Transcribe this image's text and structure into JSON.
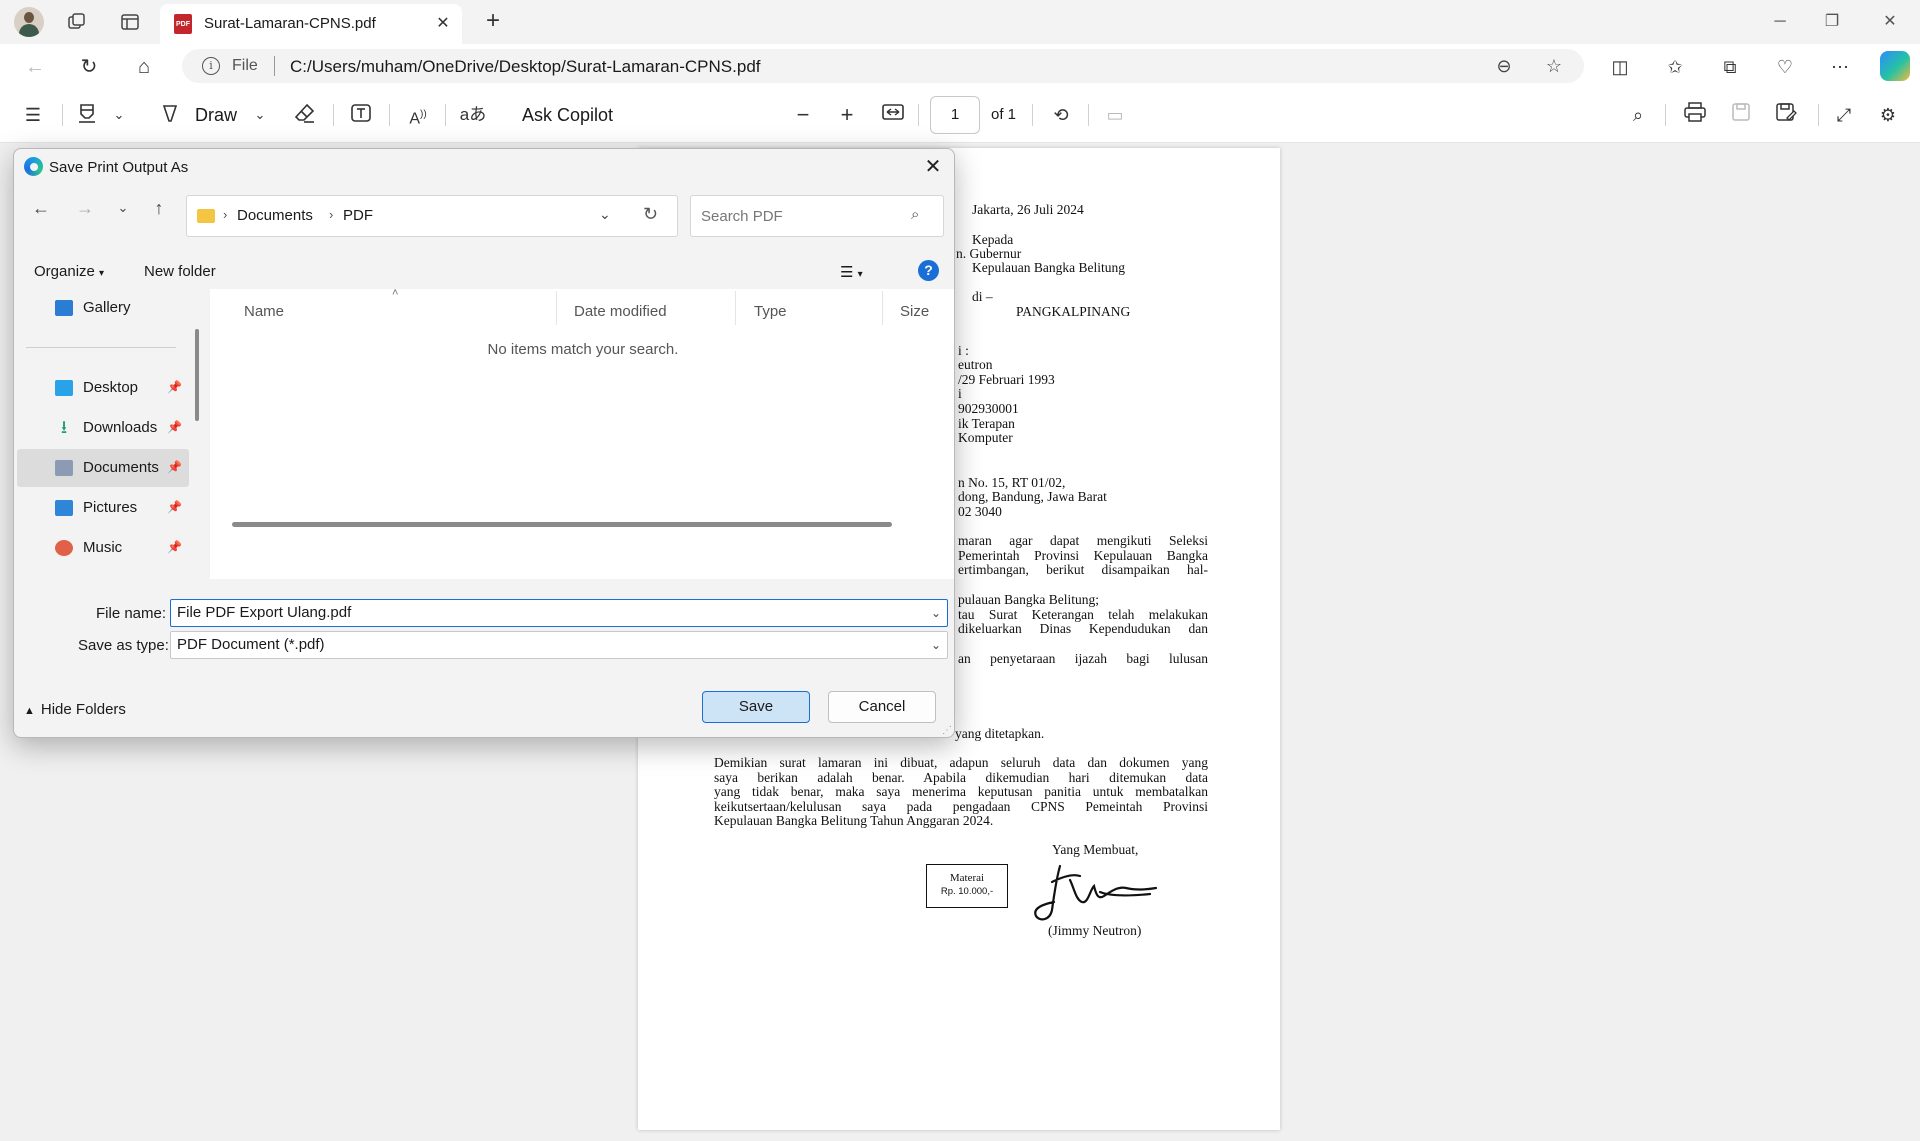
{
  "browser": {
    "tab_title": "Surat-Lamaran-CPNS.pdf",
    "tab_icon_text": "PDF",
    "scheme": "File",
    "url": "C:/Users/muham/OneDrive/Desktop/Surat-Lamaran-CPNS.pdf"
  },
  "pdf_toolbar": {
    "draw_label": "Draw",
    "ask_copilot_label": "Ask Copilot",
    "page_number": "1",
    "page_total": "of 1"
  },
  "document": {
    "date": "Jakarta, 26 Juli 2024",
    "recipient": [
      "Kepada",
      "n.  Gubernur",
      "Kepulauan Bangka Belitung",
      "di –",
      "PANGKALPINANG"
    ],
    "identity": [
      "i :",
      "eutron",
      "/29 Februari 1993",
      "i",
      "902930001",
      "ik Terapan",
      "Komputer"
    ],
    "address": [
      "n No. 15, RT 01/02,",
      "dong, Bandung, Jawa Barat",
      "02 3040"
    ],
    "body_lines": [
      "maran agar dapat mengikuti Seleksi",
      "Pemerintah Provinsi Kepulauan Bangka",
      "ertimbangan, berikut disampaikan hal-"
    ],
    "list_lines": [
      "pulauan Bangka Belitung;",
      "tau Surat Keterangan telah melakukan",
      "dikeluarkan Dinas Kependudukan dan",
      "an penyetaraan ijazah bagi lulusan"
    ],
    "partial_line": "yang ditetapkan.",
    "closing": [
      "Demikian surat lamaran ini dibuat, adapun seluruh data dan dokumen yang",
      "saya berikan adalah benar. Apabila dikemudian hari ditemukan data",
      "yang tidak benar, maka saya menerima keputusan panitia untuk membatalkan",
      "keikutsertaan/kelulusan saya pada pengadaan CPNS Pemeintah Provinsi"
    ],
    "closing_last": "Kepulauan Bangka Belitung Tahun Anggaran 2024.",
    "signoff": "Yang Membuat,",
    "materai_label": "Materai",
    "materai_value": "Rp. 10.000,-",
    "signer": "(Jimmy Neutron)"
  },
  "dialog": {
    "title": "Save Print Output As",
    "breadcrumb": [
      "Documents",
      "PDF"
    ],
    "search_placeholder": "Search PDF",
    "organize_label": "Organize",
    "new_folder_label": "New folder",
    "nav_items": [
      {
        "label": "Gallery",
        "color": "#2b7cd3"
      },
      {
        "label": "Desktop",
        "color": "#2aa2e8"
      },
      {
        "label": "Downloads",
        "color": "#1f9e6e"
      },
      {
        "label": "Documents",
        "color": "#8a9bb3"
      },
      {
        "label": "Pictures",
        "color": "#2f86d8"
      },
      {
        "label": "Music",
        "color": "#e0604a"
      }
    ],
    "columns": [
      "Name",
      "Date modified",
      "Type",
      "Size"
    ],
    "empty_message": "No items match your search.",
    "file_name_label": "File name:",
    "file_name_value": "File PDF Export Ulang.pdf",
    "save_type_label": "Save as type:",
    "save_type_value": "PDF Document (*.pdf)",
    "save_label": "Save",
    "cancel_label": "Cancel",
    "hide_folders_label": "Hide Folders"
  }
}
